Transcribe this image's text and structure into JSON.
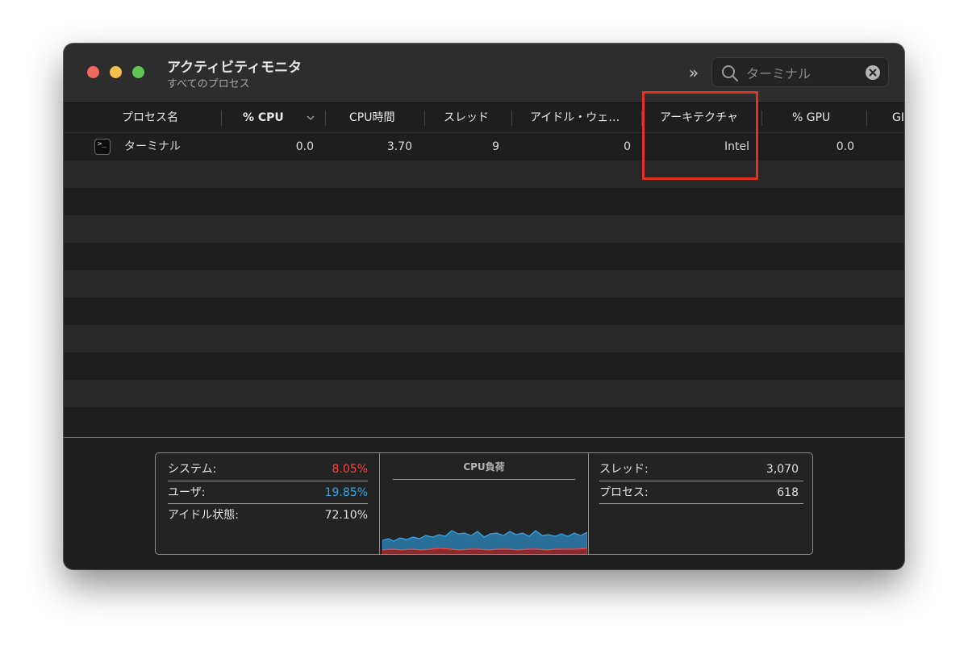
{
  "window": {
    "title": "アクティビティモニタ",
    "subtitle": "すべてのプロセス",
    "more_label": "»",
    "search": {
      "value": "ターミナル",
      "placeholder": ""
    }
  },
  "columns": [
    {
      "label": "プロセス名"
    },
    {
      "label": "% CPU"
    },
    {
      "label": "CPU時間"
    },
    {
      "label": "スレッド"
    },
    {
      "label": "アイドル・ウェ…"
    },
    {
      "label": "アーキテクチャ"
    },
    {
      "label": "% GPU"
    },
    {
      "label": "GI"
    }
  ],
  "rows": [
    {
      "name": "ターミナル",
      "cpu": "0.0",
      "cpu_time": "3.70",
      "threads": "9",
      "idle_wake": "0",
      "arch": "Intel",
      "gpu": "0.0"
    }
  ],
  "stats": {
    "system": {
      "label": "システム:",
      "value": "8.05%"
    },
    "user": {
      "label": "ユーザ:",
      "value": "19.85%"
    },
    "idle": {
      "label": "アイドル状態:",
      "value": "72.10%"
    },
    "chart_title": "CPU負荷",
    "threads": {
      "label": "スレッド:",
      "value": "3,070"
    },
    "processes": {
      "label": "プロセス:",
      "value": "618"
    }
  },
  "colors": {
    "system": "#ff453a",
    "user": "#2fa8e8",
    "highlight": "#e3321f"
  },
  "icons": {
    "search": "magnifying-glass-icon",
    "clear": "x-circle-icon",
    "sort": "chevron-down-icon",
    "app": "terminal-icon"
  }
}
